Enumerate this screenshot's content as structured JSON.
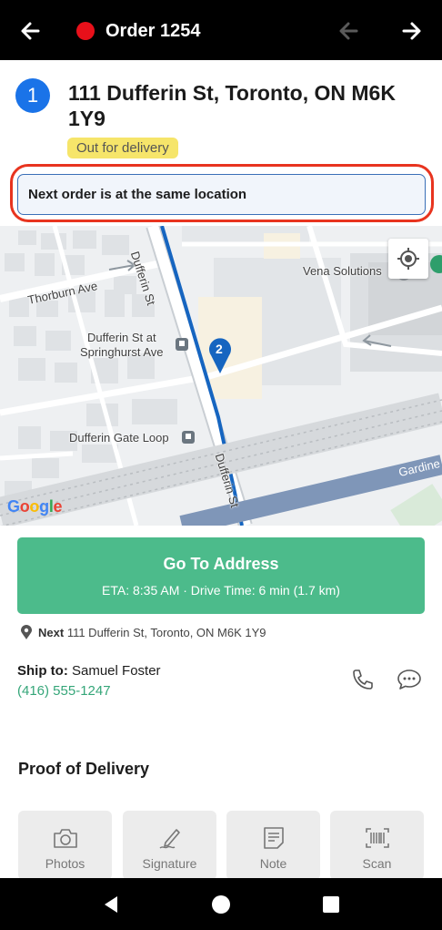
{
  "header": {
    "title": "Order 1254",
    "status_dot_color": "#e8101a"
  },
  "stop": {
    "number": "1",
    "address": "111 Dufferin St, Toronto, ON M6K 1Y9",
    "status": "Out for delivery"
  },
  "notice": "Next order is at the same location",
  "map": {
    "labels": {
      "thorburn": "Thorburn Ave",
      "dufferin_st_top": "Dufferin St",
      "dufferin_st_bottom": "Dufferin St",
      "vena": "Vena Solutions",
      "springhurst": "Dufferin St at\nSpringhurst Ave",
      "gate_loop": "Dufferin Gate Loop",
      "gardiner": "Gardine",
      "marker": "2"
    },
    "attribution": "Google"
  },
  "go_button": {
    "label": "Go To Address",
    "eta": "ETA: 8:35 AM · Drive Time: 6 min (1.7 km)"
  },
  "next_stop": {
    "prefix": "Next",
    "address": "111 Dufferin St, Toronto, ON M6K 1Y9"
  },
  "ship_to": {
    "label": "Ship to:",
    "name": "Samuel Foster",
    "phone": "(416) 555-1247"
  },
  "proof_of_delivery": {
    "title": "Proof of Delivery",
    "options": [
      "Photos",
      "Signature",
      "Note",
      "Scan"
    ]
  },
  "colors": {
    "accent": "#4cbb8b",
    "stop_blue": "#1a73e8",
    "status_yellow": "#f6e56a",
    "highlight_red": "#e8341f"
  }
}
